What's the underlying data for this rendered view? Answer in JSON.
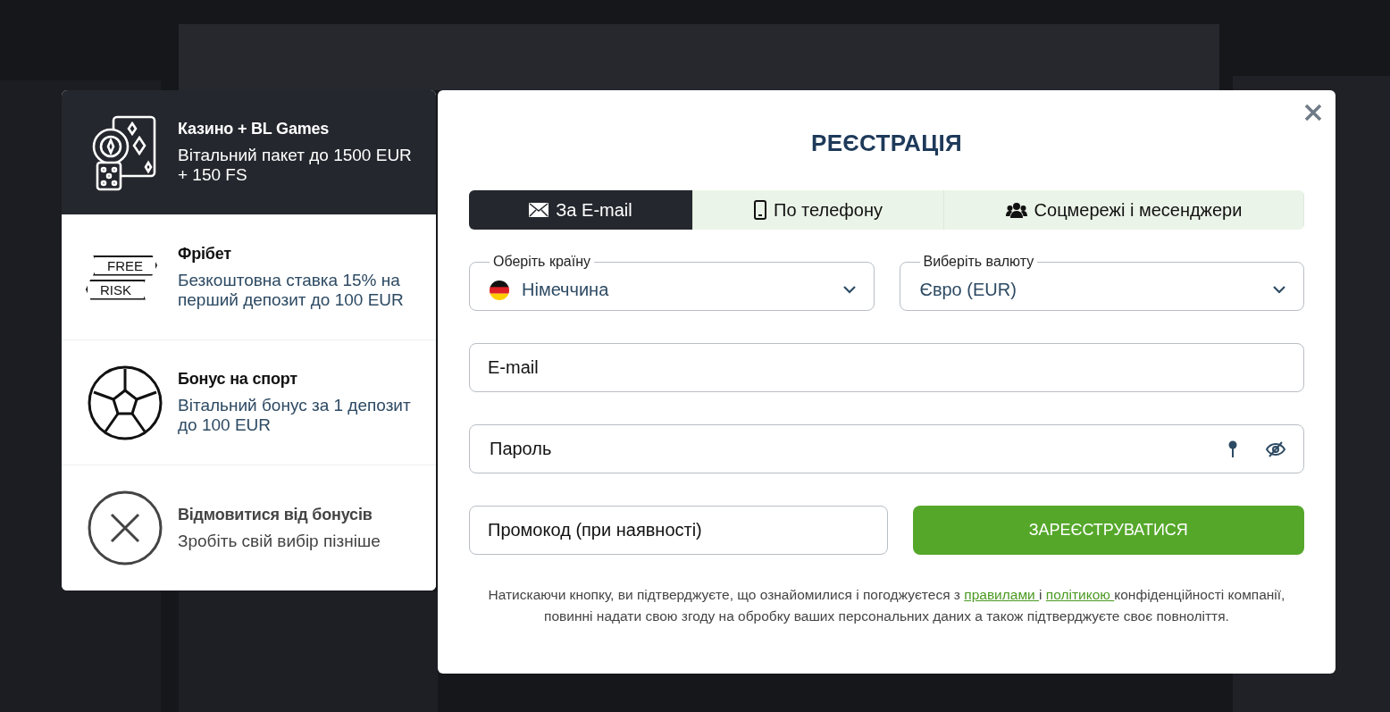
{
  "bonuses": [
    {
      "kind": "casino",
      "title": "Казино + BL Games",
      "description": "Вітальний пакет до 1500 EUR + 150 FS",
      "selected": true
    },
    {
      "kind": "freebet",
      "title": "Фрібет",
      "description": "Безкоштовна ставка 15% на перший депозит до 100 EUR",
      "selected": false,
      "icon_words": [
        "FREE",
        "RISK"
      ]
    },
    {
      "kind": "sport",
      "title": "Бонус на спорт",
      "description": "Вітальний бонус за 1 депозит до 100 EUR",
      "selected": false
    },
    {
      "kind": "none",
      "title": "Відмовитися від бонусів",
      "description": "Зробіть свій вибір пізніше",
      "selected": false
    }
  ],
  "modal": {
    "title": "РЕЄСТРАЦІЯ",
    "tabs": [
      {
        "kind": "email",
        "label": "За E-mail",
        "selected": true
      },
      {
        "kind": "phone",
        "label": "По телефону",
        "selected": false
      },
      {
        "kind": "social",
        "label": "Соцмережі і месенджери",
        "selected": false
      }
    ],
    "country": {
      "label": "Оберіть країну",
      "value": "Німеччина"
    },
    "currency": {
      "label": "Виберіть валюту",
      "value": "Євро (EUR)"
    },
    "email": {
      "placeholder": "E-mail"
    },
    "password": {
      "placeholder": "Пароль"
    },
    "promo": {
      "placeholder": "Промокод (при наявності)"
    },
    "submit": "ЗАРЕЄСТРУВАТИСЯ",
    "consent": {
      "before": "Натискаючи кнопку, ви підтверджуєте, що ознайомилися і погоджуєтеся з",
      "link_rules": "правилами",
      "middle": "і",
      "link_policy": "політикою",
      "after": "конфіденційності компанії, повинні надати свою згоду на обробку ваших персональних даних а також підтверджуєте своє повноліття."
    }
  }
}
